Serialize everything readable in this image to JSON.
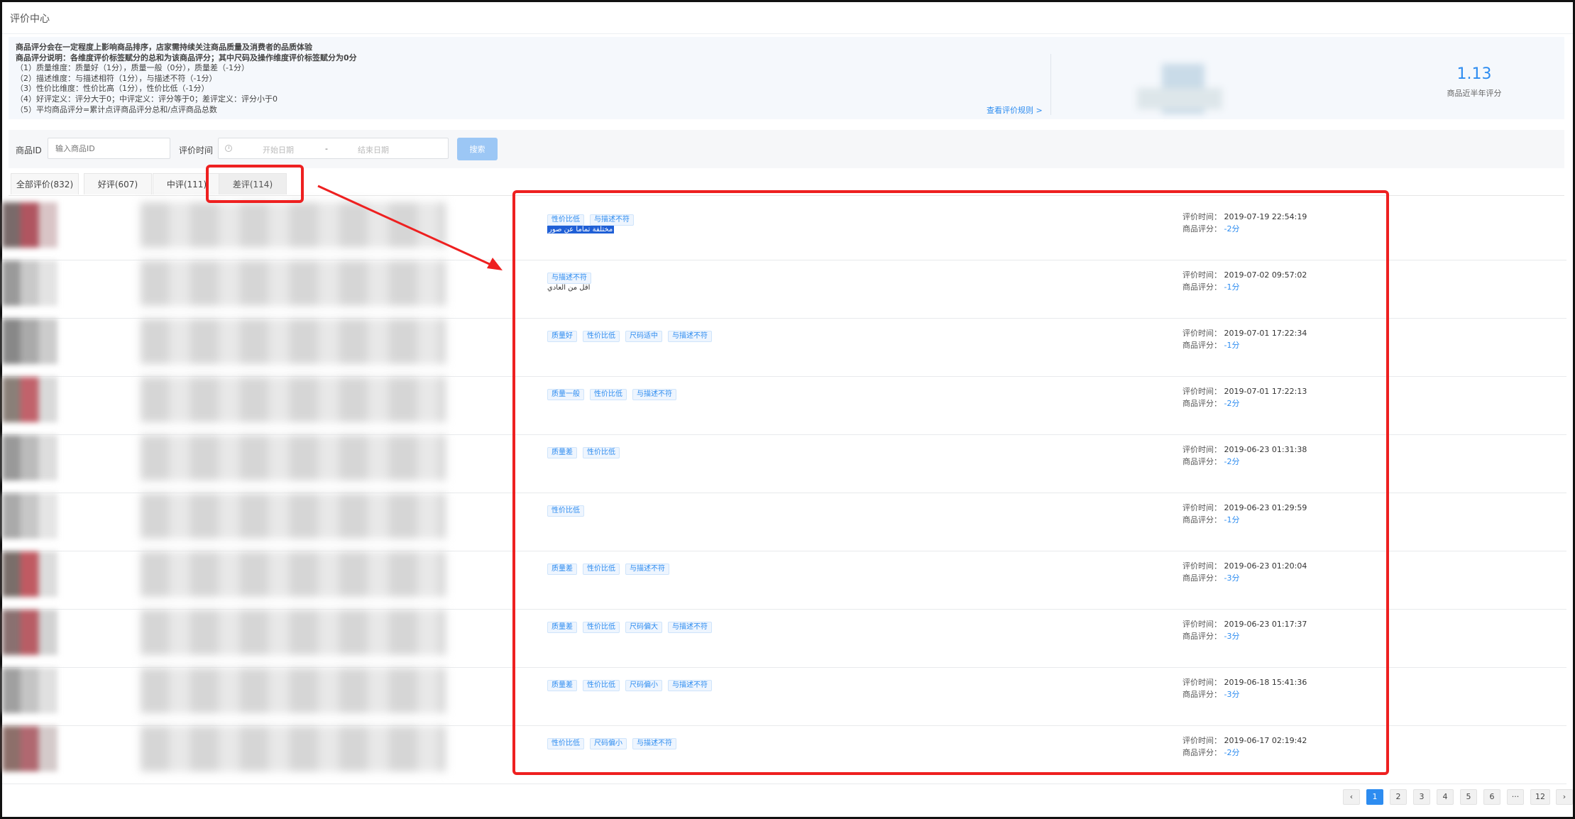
{
  "page_title": "评价中心",
  "info": {
    "lines": [
      "商品评分会在一定程度上影响商品排序，店家需持续关注商品质量及消费者的品质体验",
      "商品评分说明：各维度评价标签赋分的总和为该商品评分；其中尺码及操作维度评价标签赋分为0分",
      "（1）质量维度：质量好（1分），质量一般（0分），质量差（-1分）",
      "（2）描述维度：与描述相符（1分），与描述不符（-1分）",
      "（3）性价比维度：性价比高（1分），性价比低（-1分）",
      "（4）好评定义：评分大于0；中评定义：评分等于0；差评定义：评分小于0",
      "（5）平均商品评分=累计点评商品评分总和/点评商品总数"
    ],
    "rules_link": "查看评价规则 >",
    "score_value": "1.13",
    "score_label": "商品近半年评分"
  },
  "filters": {
    "product_id_label": "商品ID",
    "product_id_placeholder": "输入商品ID",
    "time_label": "评价时间",
    "start_placeholder": "开始日期",
    "separator": "-",
    "end_placeholder": "结束日期",
    "search_button": "搜索"
  },
  "tabs": [
    "全部评价(832)",
    "好评(607)",
    "中评(111)",
    "差评(114)"
  ],
  "reviews": [
    {
      "tags": [
        "性价比低",
        "与描述不符"
      ],
      "content": "مختلفة تماما عن صور",
      "highlight": true,
      "time": "2019-07-19 22:54:19",
      "score": "-2分"
    },
    {
      "tags": [
        "与描述不符"
      ],
      "content": "اقل من العادي",
      "highlight": false,
      "time": "2019-07-02 09:57:02",
      "score": "-1分"
    },
    {
      "tags": [
        "质量好",
        "性价比低",
        "尺码适中",
        "与描述不符"
      ],
      "content": "",
      "highlight": false,
      "time": "2019-07-01 17:22:34",
      "score": "-1分"
    },
    {
      "tags": [
        "质量一般",
        "性价比低",
        "与描述不符"
      ],
      "content": "",
      "highlight": false,
      "time": "2019-07-01 17:22:13",
      "score": "-2分"
    },
    {
      "tags": [
        "质量差",
        "性价比低"
      ],
      "content": "",
      "highlight": false,
      "time": "2019-06-23 01:31:38",
      "score": "-2分"
    },
    {
      "tags": [
        "性价比低"
      ],
      "content": "",
      "highlight": false,
      "time": "2019-06-23 01:29:59",
      "score": "-1分"
    },
    {
      "tags": [
        "质量差",
        "性价比低",
        "与描述不符"
      ],
      "content": "",
      "highlight": false,
      "time": "2019-06-23 01:20:04",
      "score": "-3分"
    },
    {
      "tags": [
        "质量差",
        "性价比低",
        "尺码偏大",
        "与描述不符"
      ],
      "content": "",
      "highlight": false,
      "time": "2019-06-23 01:17:37",
      "score": "-3分"
    },
    {
      "tags": [
        "质量差",
        "性价比低",
        "尺码偏小",
        "与描述不符"
      ],
      "content": "",
      "highlight": false,
      "time": "2019-06-18 15:41:36",
      "score": "-3分"
    },
    {
      "tags": [
        "性价比低",
        "尺码偏小",
        "与描述不符"
      ],
      "content": "",
      "highlight": false,
      "time": "2019-06-17 02:19:42",
      "score": "-2分"
    }
  ],
  "review_labels": {
    "time": "评价时间：",
    "score": "商品评分："
  },
  "pagination": {
    "prev": "‹",
    "pages": [
      "1",
      "2",
      "3",
      "4",
      "5",
      "6",
      "···",
      "12"
    ],
    "next": "›",
    "current": "1"
  },
  "colors": {
    "accent": "#2d8cf0",
    "annotation_red": "#ee2020"
  }
}
